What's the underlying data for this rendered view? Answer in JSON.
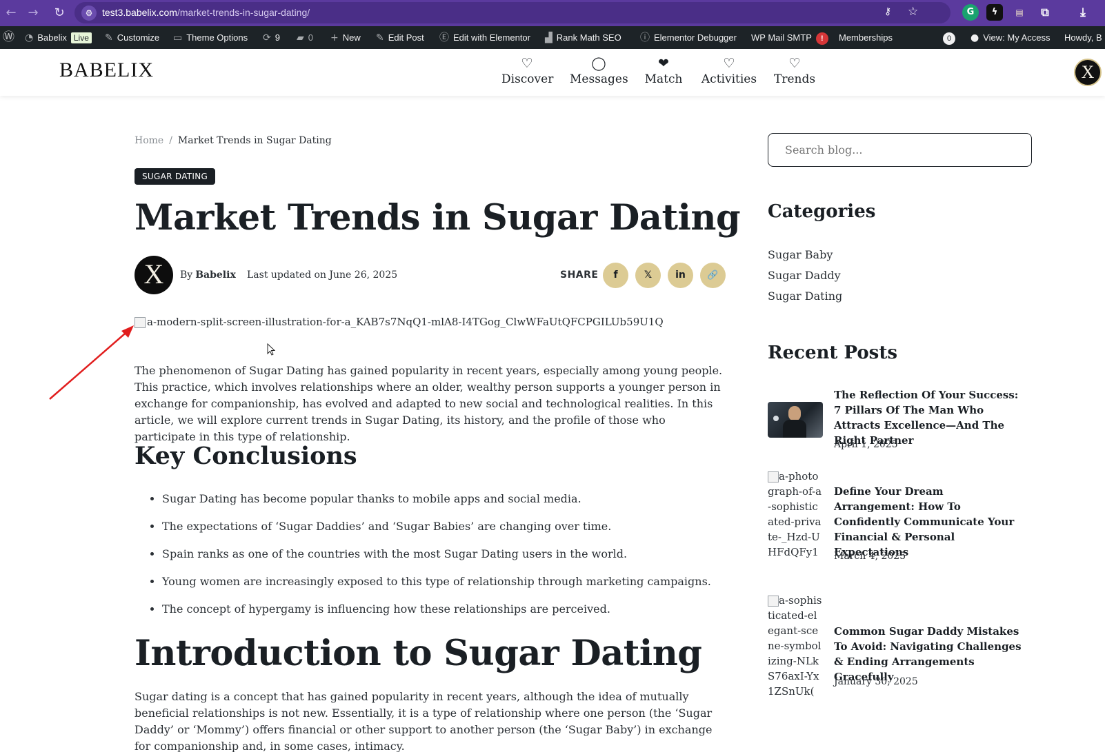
{
  "browser": {
    "url_host": "test3.babelix.com",
    "url_path": "/market-trends-in-sugar-dating/"
  },
  "wp_admin_bar": {
    "site_name": "Babelix",
    "live_badge": "Live",
    "customize": "Customize",
    "theme_options": "Theme Options",
    "updates_count": "9",
    "comments_count": "0",
    "new": "New",
    "edit_post": "Edit Post",
    "edit_with_elementor": "Edit with Elementor",
    "rank_math": "Rank Math SEO",
    "elementor_debugger": "Elementor Debugger",
    "wp_mail_smtp": "WP Mail SMTP",
    "smtp_alert": "!",
    "memberships": "Memberships",
    "notification_count": "0",
    "view_access": "View: My Access",
    "howdy": "Howdy, B"
  },
  "site": {
    "logo": "BABELIX",
    "avatar_letter": "X",
    "nav": [
      {
        "label": "Discover"
      },
      {
        "label": "Messages"
      },
      {
        "label": "Match"
      },
      {
        "label": "Activities"
      },
      {
        "label": "Trends"
      }
    ]
  },
  "post": {
    "breadcrumb_home": "Home",
    "breadcrumb_sep": "/",
    "breadcrumb_current": "Market Trends in Sugar Dating",
    "category_tag": "SUGAR DATING",
    "title": "Market Trends in Sugar Dating",
    "author_avatar_letter": "X",
    "by_label": "By",
    "author": "Babelix",
    "updated": "Last updated on June 26, 2025",
    "share_label": "SHARE",
    "share_buttons": {
      "facebook": "f",
      "x": "𝕏",
      "linkedin": "in",
      "link": "🔗"
    },
    "hero_alt": "a-modern-split-screen-illustration-for-a_KAB7s7NqQ1-mlA8-I4TGog_ClwWFaUtQFCPGILUb59U1Q",
    "intro": "The phenomenon of Sugar Dating has gained popularity in recent years, especially among young people. This practice, which involves relationships where an older, wealthy person supports a younger person in exchange for companionship, has evolved and adapted to new social and technological realities. In this article, we will explore current trends in Sugar Dating, its history, and the profile of those who participate in this type of relationship.",
    "key_heading": "Key Conclusions",
    "key_points": [
      "Sugar Dating has become popular thanks to mobile apps and social media.",
      "The expectations of ‘Sugar Daddies’ and ‘Sugar Babies’ are changing over time.",
      "Spain ranks as one of the countries with the most Sugar Dating users in the world.",
      "Young women are increasingly exposed to this type of relationship through marketing campaigns.",
      "The concept of hypergamy is influencing how these relationships are perceived."
    ],
    "intro_heading": "Introduction to Sugar Dating",
    "intro2": "Sugar dating is a concept that has gained popularity in recent years, although the idea of mutually beneficial relationships is not new. Essentially, it is a type of relationship where one person (the ‘Sugar Daddy’ or ‘Mommy’) offers financial or other support to another person (the ‘Sugar Baby’) in exchange for companionship and, in some cases, intimacy."
  },
  "sidebar": {
    "search_placeholder": "Search blog...",
    "categories_heading": "Categories",
    "categories": [
      "Sugar Baby",
      "Sugar Daddy",
      "Sugar Dating"
    ],
    "recent_heading": "Recent Posts",
    "recent_posts": [
      {
        "title": "The Reflection Of Your Success: 7 Pillars Of The Man Who Attracts Excellence—And The Right Partner",
        "date": "April 1, 2025",
        "thumb_alt": ""
      },
      {
        "title": "Define Your Dream Arrangement: How To Confidently Communicate Your Financial & Personal Expectations",
        "date": "March 4, 2025",
        "thumb_alt": "a-photograph-of-a-sophisticated-private-_Hzd-UHFdQFy1"
      },
      {
        "title": "Common Sugar Daddy Mistakes To Avoid: Navigating Challenges & Ending Arrangements Gracefully",
        "date": "January 30, 2025",
        "thumb_alt": "a-sophisticated-elegant-scene-symbolizing-NLkS76axI-Yx1ZSnUk("
      }
    ]
  },
  "annotation": {
    "arrow_color": "#e11d1d"
  },
  "colors": {
    "browser_bar": "#5b3a9e",
    "wp_bar": "#1d2327",
    "share_btn": "#dccb94",
    "text": "#1a1f24"
  }
}
